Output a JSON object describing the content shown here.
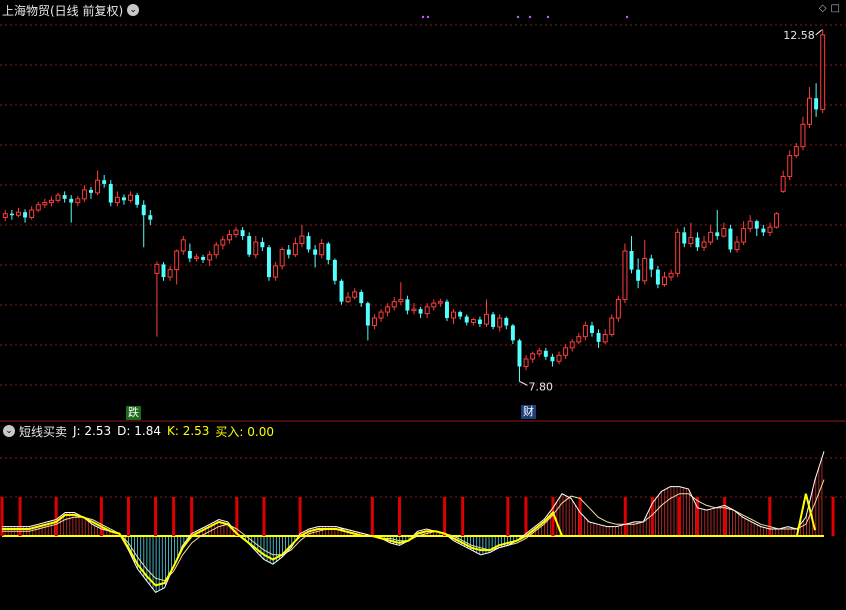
{
  "header": {
    "stock_label": "上海物贸(日线 前复权)",
    "dropdown_icon": "chevron-down-icon",
    "right_icons": [
      "diamond-icon",
      "square-icon"
    ]
  },
  "indicator_header": {
    "name": "短线买卖",
    "j": "J: 2.53",
    "d": "D: 1.84",
    "k": "K: 2.53",
    "buy": "买入: 0.00",
    "colors": {
      "name": "#e8e8e8",
      "j": "#ffffff",
      "d": "#ffffff",
      "k": "#ffff00",
      "buy": "#ffff00"
    }
  },
  "annotations": {
    "high_label": "12.58",
    "low_label": "7.80",
    "drop_tag": "跌",
    "finance_tag": "财"
  },
  "colors": {
    "up": "#ff3c3c",
    "down": "#54ffff",
    "grid": "#8b1a1a",
    "k_line": "#ffff00",
    "j_line": "#ffffff",
    "signal_bar": "#e00000"
  },
  "chart_data": [
    {
      "type": "candlestick",
      "title": "上海物贸(日线 前复权)",
      "ylim": [
        7.6,
        12.7
      ],
      "high_marker": 12.58,
      "low_marker": 7.8,
      "candles": [
        [
          10.05,
          10.1,
          10.15,
          10.0
        ],
        [
          10.1,
          10.08,
          10.15,
          10.02
        ],
        [
          10.08,
          10.12,
          10.18,
          10.05
        ],
        [
          10.12,
          10.05,
          10.16,
          9.98
        ],
        [
          10.05,
          10.15,
          10.2,
          10.02
        ],
        [
          10.15,
          10.22,
          10.26,
          10.12
        ],
        [
          10.22,
          10.25,
          10.3,
          10.18
        ],
        [
          10.25,
          10.28,
          10.33,
          10.2
        ],
        [
          10.28,
          10.35,
          10.38,
          10.25
        ],
        [
          10.35,
          10.3,
          10.4,
          10.25
        ],
        [
          10.3,
          10.25,
          10.35,
          9.98
        ],
        [
          10.25,
          10.3,
          10.34,
          10.2
        ],
        [
          10.3,
          10.42,
          10.48,
          10.26
        ],
        [
          10.42,
          10.38,
          10.46,
          10.3
        ],
        [
          10.38,
          10.55,
          10.68,
          10.35
        ],
        [
          10.55,
          10.5,
          10.62,
          10.45
        ],
        [
          10.5,
          10.25,
          10.55,
          10.2
        ],
        [
          10.25,
          10.32,
          10.4,
          10.2
        ],
        [
          10.32,
          10.28,
          10.36,
          10.22
        ],
        [
          10.28,
          10.35,
          10.4,
          10.25
        ],
        [
          10.35,
          10.22,
          10.38,
          10.18
        ],
        [
          10.22,
          10.08,
          10.28,
          9.65
        ],
        [
          10.08,
          10.02,
          10.15,
          9.95
        ],
        [
          9.3,
          9.42,
          9.46,
          8.45
        ],
        [
          9.42,
          9.25,
          9.45,
          9.2
        ],
        [
          9.25,
          9.35,
          9.4,
          9.2
        ],
        [
          9.35,
          9.6,
          9.62,
          9.15
        ],
        [
          9.6,
          9.75,
          9.8,
          9.55
        ],
        [
          9.6,
          9.5,
          9.7,
          9.45
        ],
        [
          9.5,
          9.52,
          9.56,
          9.46
        ],
        [
          9.52,
          9.48,
          9.55,
          9.44
        ],
        [
          9.48,
          9.55,
          9.6,
          9.4
        ],
        [
          9.55,
          9.68,
          9.72,
          9.5
        ],
        [
          9.68,
          9.75,
          9.8,
          9.62
        ],
        [
          9.75,
          9.82,
          9.88,
          9.7
        ],
        [
          9.82,
          9.88,
          9.92,
          9.78
        ],
        [
          9.88,
          9.8,
          9.92,
          9.75
        ],
        [
          9.8,
          9.55,
          9.85,
          9.52
        ],
        [
          9.55,
          9.72,
          9.8,
          9.5
        ],
        [
          9.72,
          9.65,
          9.78,
          9.6
        ],
        [
          9.65,
          9.25,
          9.68,
          9.2
        ],
        [
          9.25,
          9.4,
          9.45,
          9.2
        ],
        [
          9.4,
          9.62,
          9.65,
          9.35
        ],
        [
          9.62,
          9.55,
          9.68,
          9.5
        ],
        [
          9.55,
          9.7,
          9.78,
          9.52
        ],
        [
          9.7,
          9.8,
          9.95,
          9.65
        ],
        [
          9.8,
          9.62,
          9.85,
          9.58
        ],
        [
          9.62,
          9.55,
          9.68,
          9.38
        ],
        [
          9.55,
          9.7,
          9.76,
          9.5
        ],
        [
          9.7,
          9.48,
          9.72,
          9.42
        ],
        [
          9.48,
          9.2,
          9.5,
          9.15
        ],
        [
          9.2,
          8.92,
          9.22,
          8.88
        ],
        [
          8.92,
          8.98,
          9.05,
          8.9
        ],
        [
          8.98,
          9.05,
          9.1,
          8.95
        ],
        [
          9.05,
          8.9,
          9.08,
          8.85
        ],
        [
          8.9,
          8.6,
          8.92,
          8.4
        ],
        [
          8.6,
          8.7,
          8.75,
          8.55
        ],
        [
          8.7,
          8.78,
          8.82,
          8.65
        ],
        [
          8.78,
          8.85,
          8.9,
          8.72
        ],
        [
          8.85,
          8.92,
          8.98,
          8.8
        ],
        [
          8.92,
          8.95,
          9.18,
          8.88
        ],
        [
          8.95,
          8.8,
          9.0,
          8.75
        ],
        [
          8.8,
          8.82,
          8.9,
          8.75
        ],
        [
          8.82,
          8.76,
          8.85,
          8.7
        ],
        [
          8.76,
          8.85,
          8.9,
          8.7
        ],
        [
          8.85,
          8.9,
          8.95,
          8.8
        ],
        [
          8.9,
          8.92,
          8.96,
          8.85
        ],
        [
          8.92,
          8.7,
          8.95,
          8.66
        ],
        [
          8.7,
          8.78,
          8.82,
          8.62
        ],
        [
          8.78,
          8.72,
          8.8,
          8.68
        ],
        [
          8.72,
          8.64,
          8.75,
          8.6
        ],
        [
          8.64,
          8.68,
          8.7,
          8.6
        ],
        [
          8.68,
          8.62,
          8.72,
          8.58
        ],
        [
          8.62,
          8.75,
          8.95,
          8.58
        ],
        [
          8.75,
          8.58,
          8.78,
          8.55
        ],
        [
          8.58,
          8.7,
          8.75,
          8.52
        ],
        [
          8.7,
          8.6,
          8.72,
          8.55
        ],
        [
          8.6,
          8.4,
          8.62,
          8.35
        ],
        [
          8.4,
          8.05,
          8.42,
          7.85
        ],
        [
          8.05,
          8.15,
          8.2,
          8.0
        ],
        [
          8.15,
          8.22,
          8.25,
          8.1
        ],
        [
          8.22,
          8.26,
          8.3,
          8.18
        ],
        [
          8.26,
          8.18,
          8.3,
          8.14
        ],
        [
          8.18,
          8.12,
          8.22,
          8.05
        ],
        [
          8.12,
          8.2,
          8.25,
          8.08
        ],
        [
          8.2,
          8.3,
          8.35,
          8.15
        ],
        [
          8.3,
          8.38,
          8.42,
          8.25
        ],
        [
          8.38,
          8.45,
          8.5,
          8.35
        ],
        [
          8.45,
          8.6,
          8.65,
          8.4
        ],
        [
          8.6,
          8.5,
          8.65,
          8.45
        ],
        [
          8.5,
          8.38,
          8.55,
          8.3
        ],
        [
          8.38,
          8.48,
          8.55,
          8.35
        ],
        [
          8.48,
          8.7,
          8.75,
          8.45
        ],
        [
          8.7,
          8.95,
          9.0,
          8.65
        ],
        [
          8.95,
          9.6,
          9.7,
          8.9
        ],
        [
          9.6,
          9.35,
          9.8,
          9.3
        ],
        [
          9.35,
          9.2,
          9.5,
          9.1
        ],
        [
          9.2,
          9.5,
          9.75,
          9.15
        ],
        [
          9.5,
          9.35,
          9.55,
          9.25
        ],
        [
          9.35,
          9.15,
          9.4,
          9.1
        ],
        [
          9.15,
          9.25,
          9.32,
          9.12
        ],
        [
          9.25,
          9.3,
          9.35,
          9.2
        ],
        [
          9.3,
          9.85,
          9.9,
          9.25
        ],
        [
          9.85,
          9.7,
          9.92,
          9.65
        ],
        [
          9.7,
          9.78,
          9.98,
          9.65
        ],
        [
          9.78,
          9.65,
          9.85,
          9.6
        ],
        [
          9.65,
          9.72,
          9.8,
          9.6
        ],
        [
          9.72,
          9.85,
          9.95,
          9.68
        ],
        [
          9.85,
          9.8,
          10.15,
          9.75
        ],
        [
          9.8,
          9.9,
          9.98,
          9.78
        ],
        [
          9.9,
          9.62,
          9.95,
          9.58
        ],
        [
          9.62,
          9.72,
          9.8,
          9.58
        ],
        [
          9.72,
          9.9,
          10.0,
          9.68
        ],
        [
          9.9,
          10.0,
          10.08,
          9.85
        ],
        [
          10.0,
          9.9,
          10.02,
          9.8
        ],
        [
          9.9,
          9.85,
          9.95,
          9.8
        ],
        [
          9.85,
          9.92,
          9.98,
          9.8
        ],
        [
          9.92,
          10.1,
          10.12,
          9.9
        ],
        [
          10.4,
          10.6,
          10.68,
          10.38
        ],
        [
          10.6,
          10.88,
          10.95,
          10.55
        ],
        [
          10.88,
          11.0,
          11.05,
          10.85
        ],
        [
          11.0,
          11.3,
          11.4,
          10.95
        ],
        [
          11.3,
          11.65,
          11.8,
          11.25
        ],
        [
          11.65,
          11.5,
          11.85,
          11.4
        ],
        [
          11.5,
          12.5,
          12.58,
          11.45
        ]
      ]
    },
    {
      "type": "line",
      "title": "短线买卖",
      "series": [
        {
          "name": "J",
          "values": [
            4,
            4,
            4,
            4,
            5,
            6,
            7,
            10,
            10,
            8,
            5,
            3,
            2,
            1,
            -6,
            -14,
            -19,
            -24,
            -22,
            -13,
            -4,
            1,
            3,
            5,
            7,
            6,
            1,
            -2,
            -6,
            -10,
            -12,
            -9,
            -5,
            1,
            3,
            4,
            4,
            4,
            3,
            2,
            1,
            0,
            -1,
            -3,
            -4,
            -2,
            2,
            3,
            2,
            1,
            -2,
            -4,
            -6,
            -8,
            -7,
            -5,
            -4,
            -2,
            1,
            4,
            7,
            12,
            18,
            16,
            10,
            6,
            5,
            4,
            4,
            5,
            6,
            6,
            14,
            19,
            21,
            21,
            20,
            12,
            11,
            12,
            13,
            11,
            8,
            6,
            4,
            3,
            3,
            4,
            3,
            8,
            24,
            36
          ]
        },
        {
          "name": "K",
          "values": [
            3,
            3,
            3,
            3,
            4,
            5,
            6,
            9,
            9,
            8,
            6,
            4,
            2,
            1,
            -5,
            -12,
            -17,
            -21,
            -20,
            -13,
            -5,
            0,
            2,
            4,
            6,
            5,
            1,
            -2,
            -5,
            -8,
            -10,
            -8,
            -4,
            0,
            2,
            3,
            3,
            3,
            2,
            1,
            0,
            0,
            -1,
            -2,
            -3,
            -2,
            1,
            2,
            2,
            1,
            -1,
            -3,
            -5,
            -6,
            -6,
            -4,
            -3,
            -2,
            0,
            3,
            6,
            10,
            0,
            0,
            0,
            0,
            0,
            0,
            0,
            0,
            0,
            0,
            0,
            0,
            0,
            0,
            0,
            0,
            0,
            0,
            0,
            0,
            0,
            0,
            0,
            0,
            0,
            0,
            0,
            18,
            2.53
          ]
        },
        {
          "name": "D",
          "values": [
            2,
            2,
            2,
            2,
            3,
            4,
            5,
            7,
            8,
            8,
            7,
            5,
            3,
            1,
            -3,
            -9,
            -14,
            -18,
            -19,
            -15,
            -8,
            -3,
            0,
            2,
            4,
            5,
            3,
            0,
            -3,
            -6,
            -8,
            -8,
            -6,
            -2,
            1,
            2,
            3,
            3,
            3,
            2,
            1,
            0,
            -1,
            -1,
            -2,
            -2,
            0,
            1,
            2,
            1,
            0,
            -2,
            -4,
            -5,
            -6,
            -5,
            -4,
            -3,
            -1,
            2,
            5,
            9,
            14,
            17,
            16,
            12,
            8,
            6,
            5,
            5,
            5,
            6,
            9,
            13,
            16,
            18,
            18,
            15,
            13,
            12,
            12,
            11,
            9,
            7,
            5,
            4,
            3,
            3,
            3,
            5,
            14,
            24
          ]
        }
      ],
      "k_spikes": [
        28,
        40
      ],
      "signal_bars": [
        0,
        2,
        6,
        11,
        14,
        17,
        19,
        21,
        26,
        29,
        33,
        41,
        44,
        49,
        51,
        56,
        58,
        61,
        64,
        69,
        72,
        75,
        77,
        80,
        85,
        92
      ]
    }
  ]
}
